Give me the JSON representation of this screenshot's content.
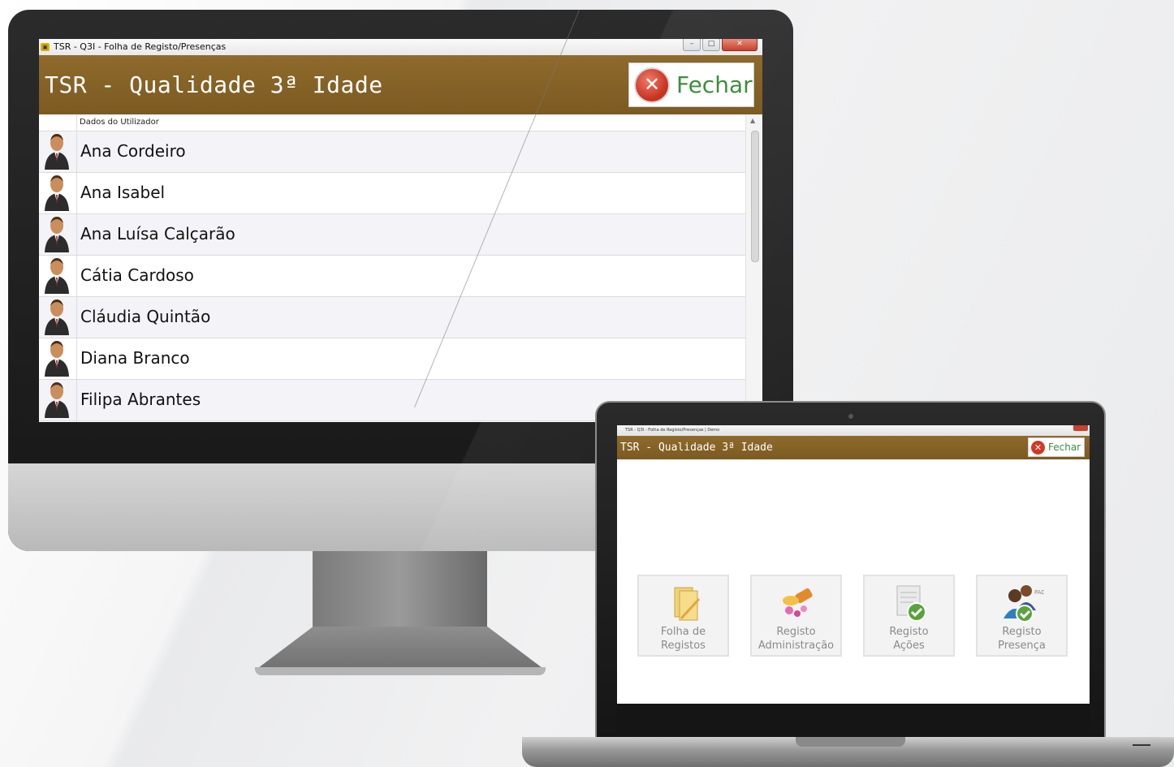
{
  "desktop": {
    "window_title": "TSR - Q3I - Folha de Registo/Presenças",
    "app_title": "TSR - Qualidade 3ª Idade",
    "close_label": "Fechar",
    "column_header": "Dados do Utilizador",
    "users": [
      {
        "name": "Ana Cordeiro"
      },
      {
        "name": "Ana Isabel"
      },
      {
        "name": "Ana Luísa Calçarão"
      },
      {
        "name": "Cátia Cardoso"
      },
      {
        "name": "Cláudia Quintão"
      },
      {
        "name": "Diana Branco"
      },
      {
        "name": "Filipa Abrantes"
      }
    ]
  },
  "laptop": {
    "window_title": "TSR - Q3I - Folha de Registo/Presenças | Demo",
    "app_title": "TSR - Qualidade 3ª Idade",
    "close_label": "Fechar",
    "tiles": [
      {
        "line1": "Folha de",
        "line2": "Registos",
        "icon": "folder-icon"
      },
      {
        "line1": "Registo",
        "line2": "Administração",
        "icon": "medicine-icon"
      },
      {
        "line1": "Registo",
        "line2": "Ações",
        "icon": "checklist-icon"
      },
      {
        "line1": "Registo",
        "line2": "Presença",
        "icon": "users-check-icon",
        "badge": "PADP"
      }
    ]
  },
  "colors": {
    "header_brown": "#86632a",
    "close_green": "#3d8f3c",
    "close_red": "#c9331f"
  }
}
